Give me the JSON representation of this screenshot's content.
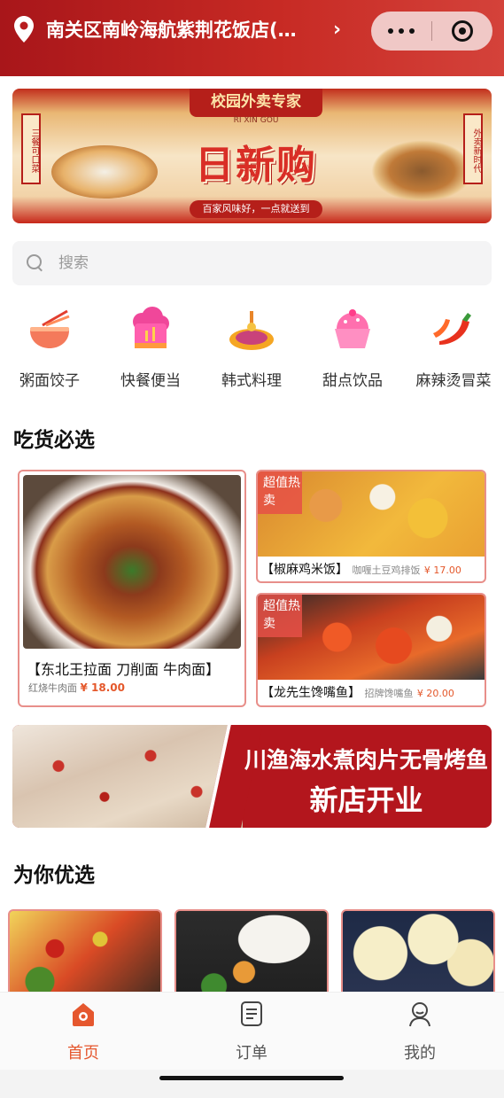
{
  "header": {
    "location_text": "南关区南岭海航紫荆花饭店(…",
    "accent_color": "#b81c1e"
  },
  "banner": {
    "ribbon": "校园外卖专家",
    "ribbon_sub": "RI XIN GOU",
    "title": "日新购",
    "left_scroll": "三餐可口菜",
    "right_scroll": "外卖新时代",
    "slogan": "百家风味好，一点就送到"
  },
  "search": {
    "placeholder": "搜索"
  },
  "categories": [
    {
      "label": "粥面饺子",
      "icon": "noodle-bowl-icon"
    },
    {
      "label": "快餐便当",
      "icon": "chef-hat-icon"
    },
    {
      "label": "韩式料理",
      "icon": "korean-bbq-icon"
    },
    {
      "label": "甜点饮品",
      "icon": "cupcake-icon"
    },
    {
      "label": "麻辣烫冒菜",
      "icon": "chili-icon"
    }
  ],
  "picks": {
    "title": "吃货必选",
    "big": {
      "name": "【东北王拉面 刀削面 牛肉面】",
      "dish": "红烧牛肉面",
      "price": "¥ 18.00"
    },
    "small": [
      {
        "tag": "超值热卖",
        "name": "【椒麻鸡米饭】",
        "dish": "咖喱土豆鸡排饭",
        "price": "¥ 17.00"
      },
      {
        "tag": "超值热卖",
        "name": "【龙先生馋嘴鱼】",
        "dish": "招牌馋嘴鱼",
        "price": "¥ 20.00"
      }
    ]
  },
  "promo": {
    "line1": "川渔海水煮肉片无骨烤鱼",
    "line2": "新店开业"
  },
  "recommend": {
    "title": "为你优选"
  },
  "tabbar": {
    "active_color": "#e5572e",
    "tabs": [
      {
        "label": "首页",
        "icon": "home-icon",
        "active": true
      },
      {
        "label": "订单",
        "icon": "order-icon",
        "active": false
      },
      {
        "label": "我的",
        "icon": "profile-icon",
        "active": false
      }
    ]
  }
}
